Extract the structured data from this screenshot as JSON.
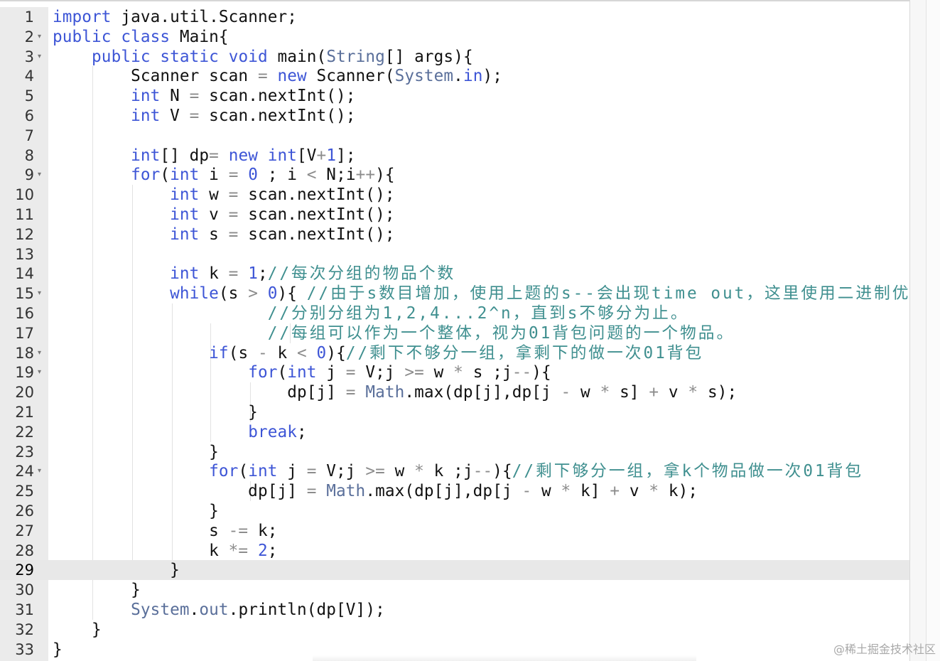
{
  "editor": {
    "language": "java",
    "active_line": 29,
    "colors": {
      "keyword": "#3d55d6",
      "number": "#3d55d6",
      "operator": "#8c8c8c",
      "class": "#5a6f9a",
      "comment": "#3f8f8f",
      "gutter_bg": "#ebebeb",
      "active_line_bg": "#e8e8e8"
    },
    "lines": [
      {
        "n": "1",
        "fold": false,
        "tokens": [
          [
            "kw",
            "import"
          ],
          [
            "t",
            " java.util.Scanner;"
          ]
        ]
      },
      {
        "n": "2",
        "fold": true,
        "tokens": [
          [
            "kw",
            "public"
          ],
          [
            "t",
            " "
          ],
          [
            "kw",
            "class"
          ],
          [
            "t",
            " Main{"
          ]
        ]
      },
      {
        "n": "3",
        "fold": true,
        "tokens": [
          [
            "t",
            "    "
          ],
          [
            "kw",
            "public"
          ],
          [
            "t",
            " "
          ],
          [
            "kw",
            "static"
          ],
          [
            "t",
            " "
          ],
          [
            "kw",
            "void"
          ],
          [
            "t",
            " main("
          ],
          [
            "cls",
            "String"
          ],
          [
            "t",
            "[] args){"
          ]
        ]
      },
      {
        "n": "4",
        "fold": false,
        "tokens": [
          [
            "t",
            "        Scanner scan "
          ],
          [
            "op",
            "="
          ],
          [
            "t",
            " "
          ],
          [
            "kw",
            "new"
          ],
          [
            "t",
            " Scanner("
          ],
          [
            "cls",
            "System"
          ],
          [
            "t",
            "."
          ],
          [
            "kw",
            "in"
          ],
          [
            "t",
            ");"
          ]
        ]
      },
      {
        "n": "5",
        "fold": false,
        "tokens": [
          [
            "t",
            "        "
          ],
          [
            "kw",
            "int"
          ],
          [
            "t",
            " N "
          ],
          [
            "op",
            "="
          ],
          [
            "t",
            " scan.nextInt();"
          ]
        ]
      },
      {
        "n": "6",
        "fold": false,
        "tokens": [
          [
            "t",
            "        "
          ],
          [
            "kw",
            "int"
          ],
          [
            "t",
            " V "
          ],
          [
            "op",
            "="
          ],
          [
            "t",
            " scan.nextInt();"
          ]
        ]
      },
      {
        "n": "7",
        "fold": false,
        "tokens": []
      },
      {
        "n": "8",
        "fold": false,
        "tokens": [
          [
            "t",
            "        "
          ],
          [
            "kw",
            "int"
          ],
          [
            "t",
            "[] dp"
          ],
          [
            "op",
            "="
          ],
          [
            "t",
            " "
          ],
          [
            "kw",
            "new"
          ],
          [
            "t",
            " "
          ],
          [
            "kw",
            "int"
          ],
          [
            "t",
            "[V"
          ],
          [
            "op",
            "+"
          ],
          [
            "num",
            "1"
          ],
          [
            "t",
            "];"
          ]
        ]
      },
      {
        "n": "9",
        "fold": true,
        "tokens": [
          [
            "t",
            "        "
          ],
          [
            "kw",
            "for"
          ],
          [
            "t",
            "("
          ],
          [
            "kw",
            "int"
          ],
          [
            "t",
            " i "
          ],
          [
            "op",
            "="
          ],
          [
            "t",
            " "
          ],
          [
            "num",
            "0"
          ],
          [
            "t",
            " ; i "
          ],
          [
            "op",
            "<"
          ],
          [
            "t",
            " N;i"
          ],
          [
            "op",
            "++"
          ],
          [
            "t",
            "){"
          ]
        ]
      },
      {
        "n": "10",
        "fold": false,
        "tokens": [
          [
            "t",
            "            "
          ],
          [
            "kw",
            "int"
          ],
          [
            "t",
            " w "
          ],
          [
            "op",
            "="
          ],
          [
            "t",
            " scan.nextInt();"
          ]
        ]
      },
      {
        "n": "11",
        "fold": false,
        "tokens": [
          [
            "t",
            "            "
          ],
          [
            "kw",
            "int"
          ],
          [
            "t",
            " v "
          ],
          [
            "op",
            "="
          ],
          [
            "t",
            " scan.nextInt();"
          ]
        ]
      },
      {
        "n": "12",
        "fold": false,
        "tokens": [
          [
            "t",
            "            "
          ],
          [
            "kw",
            "int"
          ],
          [
            "t",
            " s "
          ],
          [
            "op",
            "="
          ],
          [
            "t",
            " scan.nextInt();"
          ]
        ]
      },
      {
        "n": "13",
        "fold": false,
        "tokens": []
      },
      {
        "n": "14",
        "fold": false,
        "tokens": [
          [
            "t",
            "            "
          ],
          [
            "kw",
            "int"
          ],
          [
            "t",
            " k "
          ],
          [
            "op",
            "="
          ],
          [
            "t",
            " "
          ],
          [
            "num",
            "1"
          ],
          [
            "t",
            ";"
          ],
          [
            "cm",
            "//每次分组的物品个数"
          ]
        ]
      },
      {
        "n": "15",
        "fold": true,
        "tokens": [
          [
            "t",
            "            "
          ],
          [
            "kw",
            "while"
          ],
          [
            "t",
            "(s "
          ],
          [
            "op",
            ">"
          ],
          [
            "t",
            " "
          ],
          [
            "num",
            "0"
          ],
          [
            "t",
            "){ "
          ],
          [
            "cm",
            "//由于s数目增加，使用上题的s--会出现time out，这里使用二进制优化"
          ]
        ]
      },
      {
        "n": "16",
        "fold": false,
        "tokens": [
          [
            "t",
            "                      "
          ],
          [
            "cm",
            "//分别分组为1,2,4...2^n，直到s不够分为止。"
          ]
        ]
      },
      {
        "n": "17",
        "fold": false,
        "tokens": [
          [
            "t",
            "                      "
          ],
          [
            "cm",
            "//每组可以作为一个整体，视为01背包问题的一个物品。"
          ]
        ]
      },
      {
        "n": "18",
        "fold": true,
        "tokens": [
          [
            "t",
            "                "
          ],
          [
            "kw",
            "if"
          ],
          [
            "t",
            "(s "
          ],
          [
            "op",
            "-"
          ],
          [
            "t",
            " k "
          ],
          [
            "op",
            "<"
          ],
          [
            "t",
            " "
          ],
          [
            "num",
            "0"
          ],
          [
            "t",
            "){"
          ],
          [
            "cm",
            "//剩下不够分一组，拿剩下的做一次01背包"
          ]
        ]
      },
      {
        "n": "19",
        "fold": true,
        "tokens": [
          [
            "t",
            "                    "
          ],
          [
            "kw",
            "for"
          ],
          [
            "t",
            "("
          ],
          [
            "kw",
            "int"
          ],
          [
            "t",
            " j "
          ],
          [
            "op",
            "="
          ],
          [
            "t",
            " V;j "
          ],
          [
            "op",
            ">="
          ],
          [
            "t",
            " w "
          ],
          [
            "op",
            "*"
          ],
          [
            "t",
            " s ;j"
          ],
          [
            "op",
            "--"
          ],
          [
            "t",
            "){"
          ]
        ]
      },
      {
        "n": "20",
        "fold": false,
        "tokens": [
          [
            "t",
            "                        dp[j] "
          ],
          [
            "op",
            "="
          ],
          [
            "t",
            " "
          ],
          [
            "cls",
            "Math"
          ],
          [
            "t",
            ".max(dp[j],dp[j "
          ],
          [
            "op",
            "-"
          ],
          [
            "t",
            " w "
          ],
          [
            "op",
            "*"
          ],
          [
            "t",
            " s] "
          ],
          [
            "op",
            "+"
          ],
          [
            "t",
            " v "
          ],
          [
            "op",
            "*"
          ],
          [
            "t",
            " s);"
          ]
        ]
      },
      {
        "n": "21",
        "fold": false,
        "tokens": [
          [
            "t",
            "                    }"
          ]
        ]
      },
      {
        "n": "22",
        "fold": false,
        "tokens": [
          [
            "t",
            "                    "
          ],
          [
            "kw",
            "break"
          ],
          [
            "t",
            ";"
          ]
        ]
      },
      {
        "n": "23",
        "fold": false,
        "tokens": [
          [
            "t",
            "                }"
          ]
        ]
      },
      {
        "n": "24",
        "fold": true,
        "tokens": [
          [
            "t",
            "                "
          ],
          [
            "kw",
            "for"
          ],
          [
            "t",
            "("
          ],
          [
            "kw",
            "int"
          ],
          [
            "t",
            " j "
          ],
          [
            "op",
            "="
          ],
          [
            "t",
            " V;j "
          ],
          [
            "op",
            ">="
          ],
          [
            "t",
            " w "
          ],
          [
            "op",
            "*"
          ],
          [
            "t",
            " k ;j"
          ],
          [
            "op",
            "--"
          ],
          [
            "t",
            "){"
          ],
          [
            "cm",
            "//剩下够分一组，拿k个物品做一次01背包"
          ]
        ]
      },
      {
        "n": "25",
        "fold": false,
        "tokens": [
          [
            "t",
            "                    dp[j] "
          ],
          [
            "op",
            "="
          ],
          [
            "t",
            " "
          ],
          [
            "cls",
            "Math"
          ],
          [
            "t",
            ".max(dp[j],dp[j "
          ],
          [
            "op",
            "-"
          ],
          [
            "t",
            " w "
          ],
          [
            "op",
            "*"
          ],
          [
            "t",
            " k] "
          ],
          [
            "op",
            "+"
          ],
          [
            "t",
            " v "
          ],
          [
            "op",
            "*"
          ],
          [
            "t",
            " k);"
          ]
        ]
      },
      {
        "n": "26",
        "fold": false,
        "tokens": [
          [
            "t",
            "                }"
          ]
        ]
      },
      {
        "n": "27",
        "fold": false,
        "tokens": [
          [
            "t",
            "                s "
          ],
          [
            "op",
            "-="
          ],
          [
            "t",
            " k;"
          ]
        ]
      },
      {
        "n": "28",
        "fold": false,
        "tokens": [
          [
            "t",
            "                k "
          ],
          [
            "op",
            "*="
          ],
          [
            "t",
            " "
          ],
          [
            "num",
            "2"
          ],
          [
            "t",
            ";"
          ]
        ]
      },
      {
        "n": "29",
        "fold": false,
        "tokens": [
          [
            "t",
            "            }"
          ]
        ]
      },
      {
        "n": "30",
        "fold": false,
        "tokens": [
          [
            "t",
            "        }"
          ]
        ]
      },
      {
        "n": "31",
        "fold": false,
        "tokens": [
          [
            "t",
            "        "
          ],
          [
            "cls",
            "System"
          ],
          [
            "t",
            "."
          ],
          [
            "cls",
            "out"
          ],
          [
            "t",
            ".println(dp[V]);"
          ]
        ]
      },
      {
        "n": "32",
        "fold": false,
        "tokens": [
          [
            "t",
            "    }"
          ]
        ]
      },
      {
        "n": "33",
        "fold": false,
        "tokens": [
          [
            "t",
            "}"
          ]
        ]
      }
    ]
  },
  "watermark": "@稀土掘金技术社区",
  "icons": {
    "fold_marker": "chevron-down-icon"
  }
}
